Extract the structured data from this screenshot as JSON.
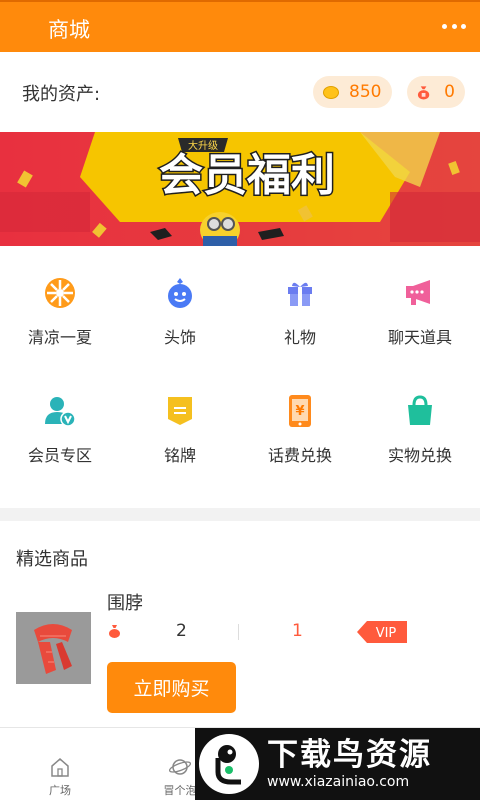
{
  "header": {
    "title": "商城",
    "more_icon": "more-icon"
  },
  "assets": {
    "label": "我的资产:",
    "coins": "850",
    "bag_count": "0"
  },
  "banner": {
    "badge": "大升级",
    "headline": "会员福利"
  },
  "categories": [
    {
      "label": "清凉一夏",
      "icon": "wheel-icon"
    },
    {
      "label": "头饰",
      "icon": "face-icon"
    },
    {
      "label": "礼物",
      "icon": "gift-icon"
    },
    {
      "label": "聊天道具",
      "icon": "megaphone-icon"
    },
    {
      "label": "会员专区",
      "icon": "member-icon"
    },
    {
      "label": "铭牌",
      "icon": "nameplate-icon"
    },
    {
      "label": "话费兑换",
      "icon": "phone-icon"
    },
    {
      "label": "实物兑换",
      "icon": "shopping-bag-icon"
    }
  ],
  "featured": {
    "heading": "精选商品",
    "product": {
      "name": "围脖",
      "price": "2",
      "vip_price": "1",
      "vip_label": "VIP",
      "buy_label": "立即购买"
    }
  },
  "tabbar": {
    "items": [
      {
        "label": "广场",
        "icon": "home-icon"
      },
      {
        "label": "冒个泡",
        "icon": "planet-icon"
      }
    ]
  },
  "watermark": {
    "title": "下载鸟资源",
    "url": "www.xiazainiao.com"
  },
  "colors": {
    "brand": "#ff8a0c",
    "vip": "#ff5a3c",
    "banner": "#e83345"
  }
}
